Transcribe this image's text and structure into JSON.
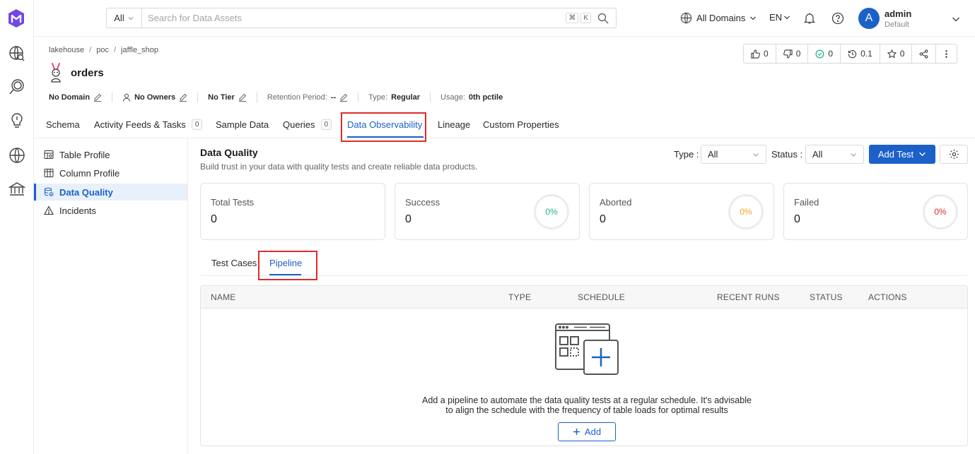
{
  "search": {
    "filter": "All",
    "placeholder": "Search for Data Assets",
    "kbd_cmd": "⌘",
    "kbd_k": "K"
  },
  "topbar": {
    "domains": "All Domains",
    "language": "EN",
    "avatar_letter": "A",
    "user_name": "admin",
    "user_role": "Default"
  },
  "breadcrumb": [
    "lakehouse",
    "poc",
    "jaffle_shop"
  ],
  "entity": {
    "name": "orders"
  },
  "stats": {
    "upvotes": "0",
    "downvotes": "0",
    "followers": "0",
    "version": "0.1",
    "stars": "0"
  },
  "meta": {
    "domain": "No Domain",
    "owners": "No Owners",
    "tier": "No Tier",
    "retention_label": "Retention Period:",
    "retention_value": "--",
    "type_label": "Type:",
    "type_value": "Regular",
    "usage_label": "Usage:",
    "usage_value": "0th pctile"
  },
  "tabs": {
    "schema": "Schema",
    "activity": "Activity Feeds & Tasks",
    "activity_count": "0",
    "sample": "Sample Data",
    "queries": "Queries",
    "queries_count": "0",
    "observability": "Data Observability",
    "lineage": "Lineage",
    "custom": "Custom Properties"
  },
  "subnav": {
    "table_profile": "Table Profile",
    "column_profile": "Column Profile",
    "data_quality": "Data Quality",
    "incidents": "Incidents"
  },
  "dq": {
    "title": "Data Quality",
    "subtitle": "Build trust in your data with quality tests and create reliable data products.",
    "type_label": "Type",
    "type_value": "All",
    "status_label": "Status",
    "status_value": "All",
    "add_test": "Add Test"
  },
  "cards": {
    "total_label": "Total Tests",
    "total_value": "0",
    "success_label": "Success",
    "success_value": "0",
    "success_pct": "0%",
    "aborted_label": "Aborted",
    "aborted_value": "0",
    "aborted_pct": "0%",
    "failed_label": "Failed",
    "failed_value": "0",
    "failed_pct": "0%"
  },
  "colors": {
    "primary": "#1b61c8",
    "success": "#1fb486",
    "aborted": "#f5a623",
    "failed": "#e02b2b",
    "highlight": "#e02b2b"
  },
  "subtabs": {
    "test_cases": "Test Cases",
    "pipeline": "Pipeline"
  },
  "table": {
    "columns": [
      "NAME",
      "TYPE",
      "SCHEDULE",
      "RECENT RUNS",
      "STATUS",
      "ACTIONS"
    ],
    "empty_line1": "Add a pipeline to automate the data quality tests at a regular schedule. It's advisable",
    "empty_line2": "to align the schedule with the frequency of table loads for optimal results",
    "add_label": "Add"
  }
}
